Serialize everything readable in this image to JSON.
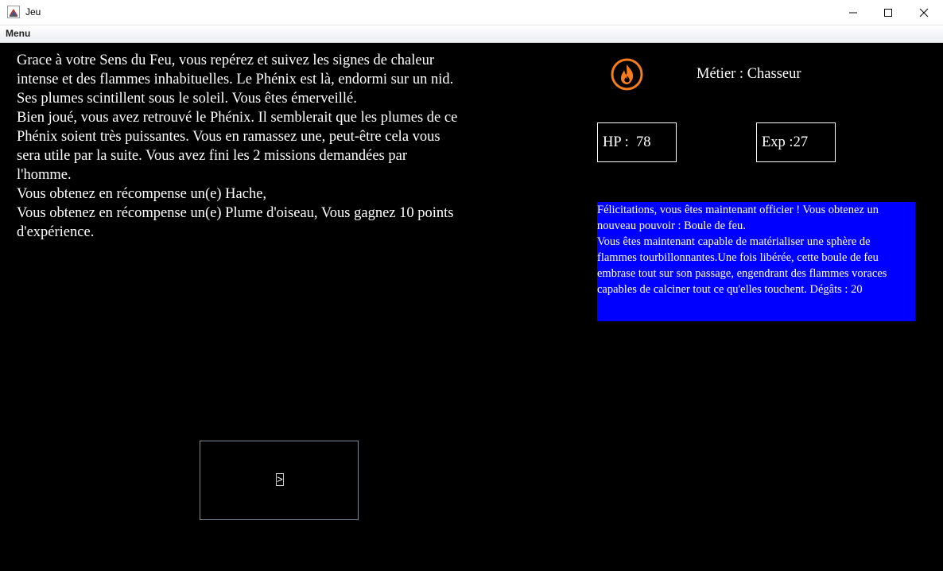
{
  "window": {
    "title": "Jeu",
    "menu_label": "Menu",
    "icons": {
      "app": "java-app-icon",
      "minimize": "minimize-icon",
      "maximize": "maximize-icon",
      "close": "close-icon"
    }
  },
  "story": {
    "text": "Grace à votre Sens du Feu, vous repérez et suivez les signes de chaleur\nintense et des flammes inhabituelles. Le Phénix est là, endormi sur un nid.\nSes plumes scintillent sous le soleil. Vous êtes émerveillé.\nBien joué, vous avez retrouvé le Phénix. Il semblerait que les plumes de ce\nPhénix soient très puissantes. Vous en ramassez une, peut-être cela vous\nsera utile par la suite. Vous avez fini les 2 missions demandées par\nl'homme.\nVous obtenez en récompense un(e) Hache,\nVous obtenez en récompense un(e) Plume d'oiseau, Vous gagnez 10 points\nd'expérience."
  },
  "choice": {
    "button_label": ">"
  },
  "player": {
    "icon": "fire-icon",
    "job_text": "Métier : Chasseur",
    "hp_text": "HP :  78",
    "exp_text": "Exp :27"
  },
  "notification": {
    "text": "Félicitations, vous êtes maintenant officier ! Vous obtenez un\nnouveau pouvoir : Boule de feu.\nVous êtes maintenant capable de matérialiser une sphère de\nflammes tourbillonnantes.Une fois libérée, cette boule de feu\nembrase tout sur son passage, engendrant des flammes voraces\ncapables de calciner tout ce qu'elles touchent. Dégâts : 20",
    "background": "#0000ff"
  },
  "colors": {
    "fire_orange": "#f57c1f",
    "background": "#000000",
    "text": "#ffffff"
  }
}
